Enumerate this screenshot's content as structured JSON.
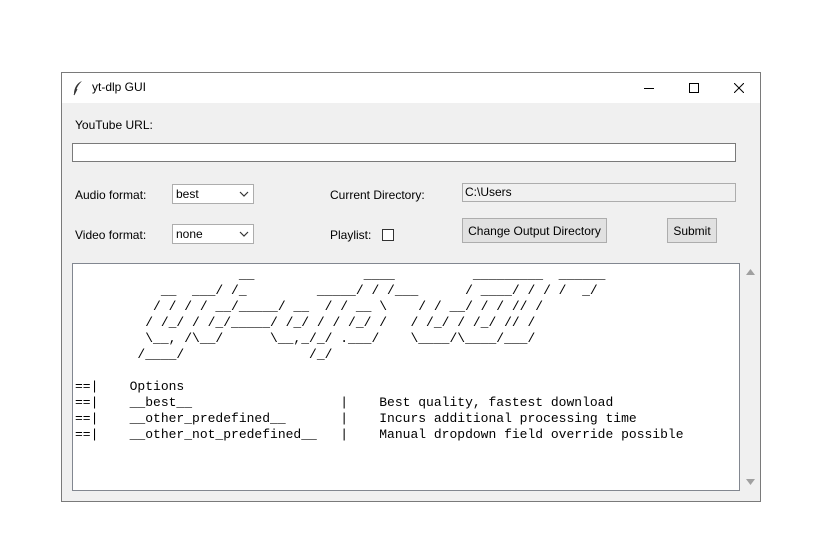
{
  "window": {
    "title": "yt-dlp GUI",
    "controls": [
      "minimize-icon",
      "maximize-icon",
      "close-icon"
    ]
  },
  "form": {
    "url_label": "YouTube URL:",
    "url_value": "",
    "audio_label": "Audio format:",
    "audio_value": "best",
    "video_label": "Video format:",
    "video_value": "none",
    "dir_label": "Current Directory:",
    "dir_value": "C:\\Users",
    "playlist_label": "Playlist:",
    "playlist_checked": false,
    "change_dir_button": "Change Output Directory",
    "submit_button": "Submit"
  },
  "console": {
    "text": "                     __              ____          _________  ______\n           __  ___/ /_         _____/ / /___      / ____/ / / /  _/\n          / / / / __/_____/ __  / / __ \\    / / __/ / / // /\n         / /_/ / /_/_____/ /_/ / / /_/ /   / /_/ / /_/ // /\n         \\__, /\\__/      \\__,_/_/ .___/    \\____/\\____/___/\n        /____/                /_/\n\n==|    Options\n==|    __best__                   |    Best quality, fastest download\n==|    __other_predefined__       |    Incurs additional processing time\n==|    __other_not_predefined__   |    Manual dropdown field override possible"
  },
  "colors": {
    "window_bg": "#f0f0f0",
    "titlebar_bg": "#ffffff",
    "border": "#7a7a7a",
    "button_bg": "#e1e1e1"
  }
}
